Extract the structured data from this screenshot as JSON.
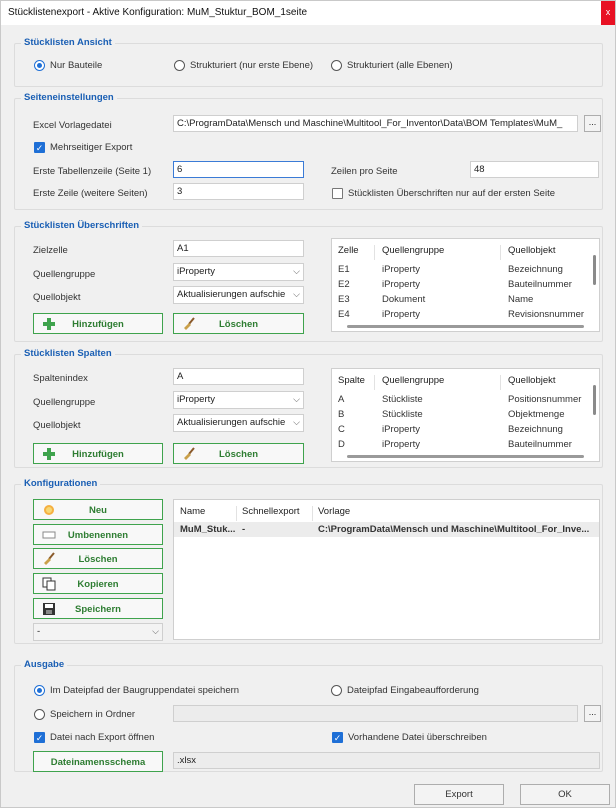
{
  "window": {
    "title": "Stücklistenexport - Aktive Konfiguration: MuM_Stuktur_BOM_1seite",
    "close_glyph": "x"
  },
  "ansicht": {
    "title": "Stücklisten Ansicht",
    "options": [
      "Nur Bauteile",
      "Strukturiert (nur erste Ebene)",
      "Strukturiert (alle Ebenen)"
    ],
    "selected_index": 0
  },
  "seite": {
    "title": "Seiteneinstellungen",
    "excel_label": "Excel Vorlagedatei",
    "excel_value": "C:\\ProgramData\\Mensch und Maschine\\Multitool_For_Inventor\\Data\\BOM Templates\\MuM_",
    "browse_label": "...",
    "mehrseitig_label": "Mehrseitiger Export",
    "mehrseitig_checked": true,
    "erste_tab_label": "Erste Tabellenzeile (Seite 1)",
    "erste_tab_value": "6",
    "zeilen_pro_label": "Zeilen pro Seite",
    "zeilen_pro_value": "48",
    "erste_zeile_label": "Erste Zeile (weitere Seiten)",
    "erste_zeile_value": "3",
    "nur_erste_label": "Stücklisten Überschriften nur auf der ersten Seite",
    "nur_erste_checked": false
  },
  "ueber": {
    "title": "Stücklisten Überschriften",
    "zielzelle_label": "Zielzelle",
    "zielzelle_value": "A1",
    "quellgruppe_label": "Quellengruppe",
    "quellgruppe_value": "iProperty",
    "quellobjekt_label": "Quellobjekt",
    "quellobjekt_value": "Aktualisierungen aufschie",
    "add_label": "Hinzufügen",
    "del_label": "Löschen",
    "columns": [
      "Zelle",
      "Quellengruppe",
      "Quellobjekt"
    ],
    "rows": [
      [
        "E1",
        "iProperty",
        "Bezeichnung"
      ],
      [
        "E2",
        "iProperty",
        "Bauteilnummer"
      ],
      [
        "E3",
        "Dokument",
        "Name"
      ],
      [
        "E4",
        "iProperty",
        "Revisionsnummer"
      ]
    ]
  },
  "spalten": {
    "title": "Stücklisten Spalten",
    "index_label": "Spaltenindex",
    "index_value": "A",
    "quellgruppe_label": "Quellengruppe",
    "quellgruppe_value": "iProperty",
    "quellobjekt_label": "Quellobjekt",
    "quellobjekt_value": "Aktualisierungen aufschie",
    "add_label": "Hinzufügen",
    "del_label": "Löschen",
    "columns": [
      "Spalte",
      "Quellengruppe",
      "Quellobjekt"
    ],
    "rows": [
      [
        "A",
        "Stückliste",
        "Positionsnummer"
      ],
      [
        "B",
        "Stückliste",
        "Objektmenge"
      ],
      [
        "C",
        "iProperty",
        "Bezeichnung"
      ],
      [
        "D",
        "iProperty",
        "Bauteilnummer"
      ]
    ]
  },
  "konfig": {
    "title": "Konfigurationen",
    "buttons": {
      "neu": "Neu",
      "umbenennen": "Umbenennen",
      "loeschen": "Löschen",
      "kopieren": "Kopieren",
      "speichern": "Speichern"
    },
    "dropdown_value": "-",
    "columns": [
      "Name",
      "Schnellexport",
      "Vorlage"
    ],
    "rows": [
      [
        "MuM_Stuk...",
        "-",
        "C:\\ProgramData\\Mensch und Maschine\\Multitool_For_Inve..."
      ]
    ]
  },
  "ausgabe": {
    "title": "Ausgabe",
    "radio_bg": "Im Dateipfad der Baugruppendatei speichern",
    "radio_prompt": "Dateipfad Eingabeaufforderung",
    "radio_ordner": "Speichern in Ordner",
    "ordner_value": "",
    "browse_label": "...",
    "oeffnen_label": "Datei nach Export öffnen",
    "oeffnen_checked": true,
    "ueberschreiben_label": "Vorhandene Datei überschreiben",
    "ueberschreiben_checked": true,
    "schema_label": "Dateinamensschema",
    "schema_value": ".xlsx"
  },
  "footer": {
    "export_label": "Export",
    "ok_label": "OK"
  },
  "colors": {
    "accent": "#1e6fd6",
    "title_blue": "#1a5fb4",
    "green": "#3fa34d",
    "close": "#e81123"
  }
}
